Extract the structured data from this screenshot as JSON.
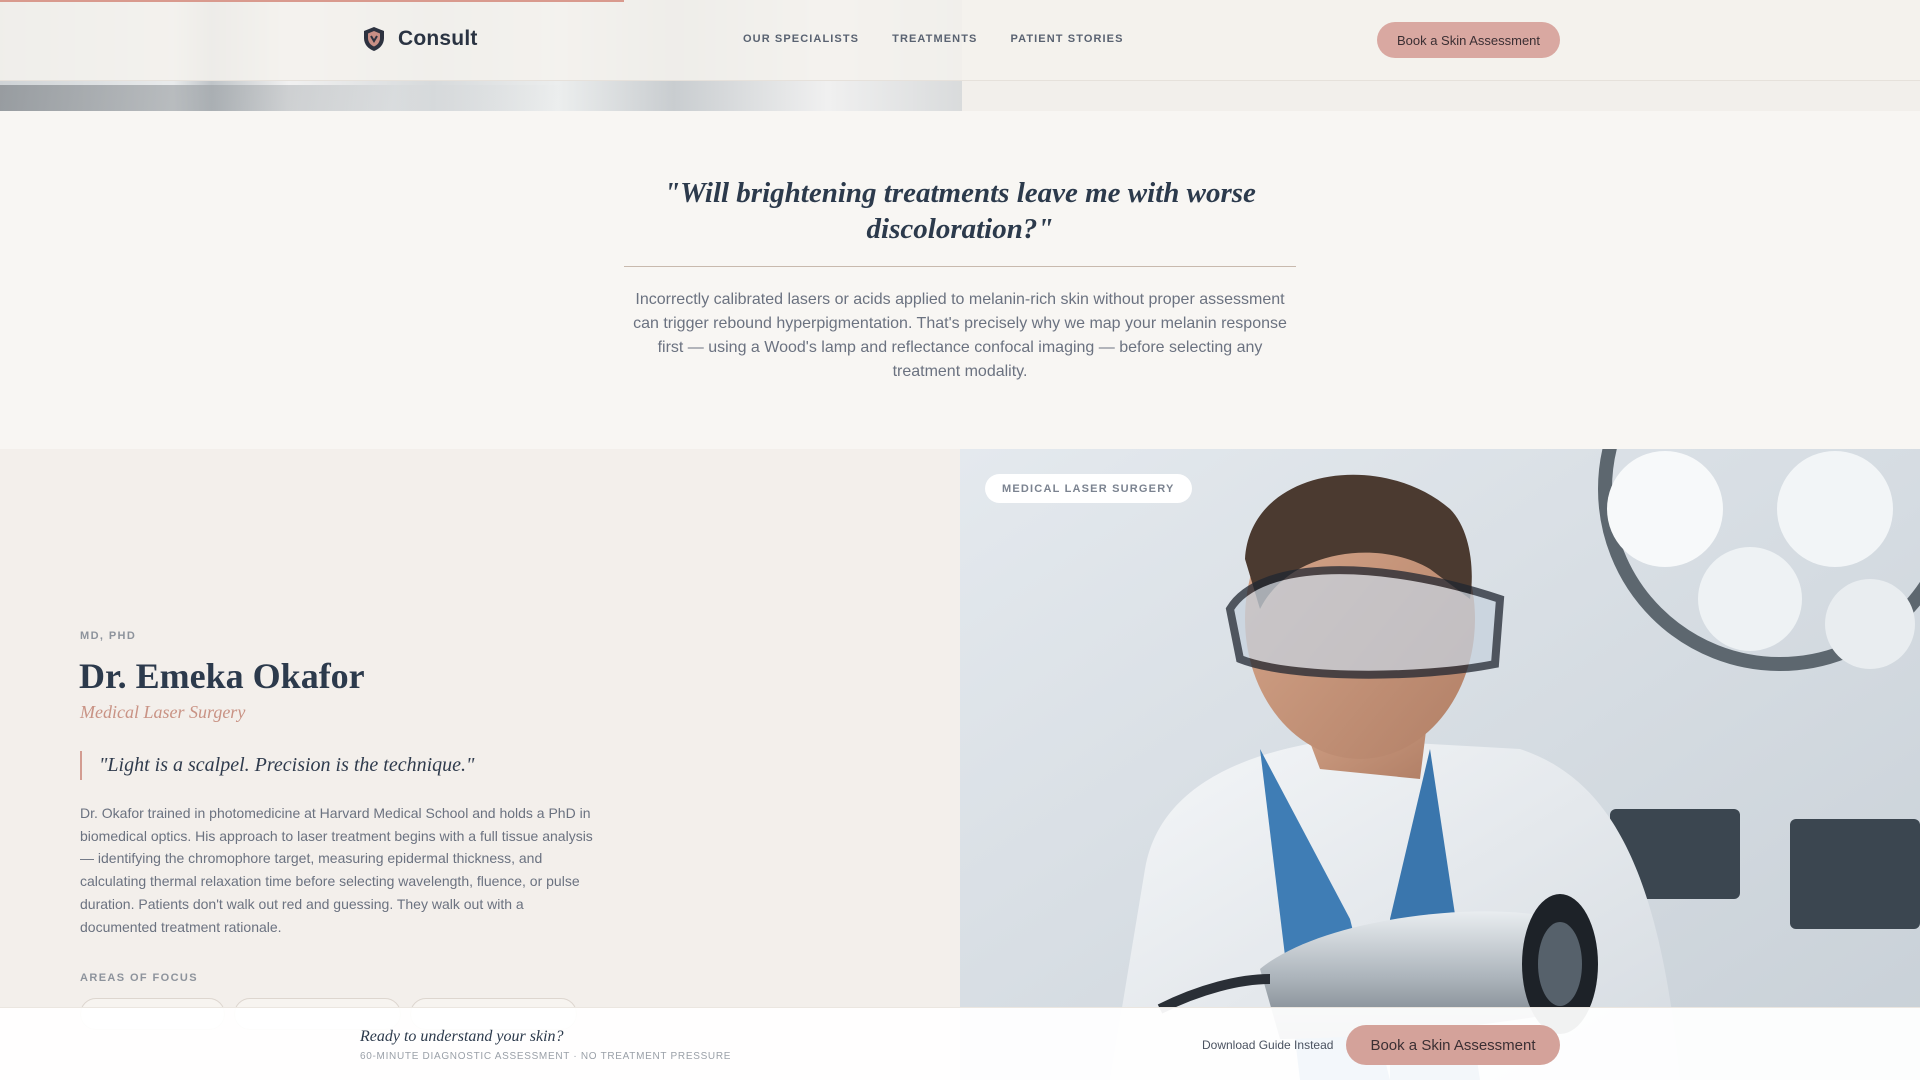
{
  "nav": {
    "brand": "Consult",
    "links": [
      "OUR SPECIALISTS",
      "TREATMENTS",
      "PATIENT STORIES"
    ],
    "cta": "Book a Skin Assessment"
  },
  "scroll_progress_percent": 32.5,
  "question": {
    "title": "\"Will brightening treatments leave me with worse discoloration?\"",
    "body": "Incorrectly calibrated lasers or acids applied to melanin-rich skin without proper assessment can trigger rebound hyperpigmentation. That's precisely why we map your melanin response first — using a Wood's lamp and reflectance confocal imaging — before selecting any treatment modality."
  },
  "specialist": {
    "credentials": "MD, PHD",
    "name": "Dr. Emeka Okafor",
    "specialty": "Medical Laser Surgery",
    "quote": "\"Light is a scalpel. Precision is the technique.\"",
    "bio": "Dr. Okafor trained in photomedicine at Harvard Medical School and holds a PhD in biomedical optics. His approach to laser treatment begins with a full tissue analysis — identifying the chromophore target, measuring epidermal thickness, and calculating thermal relaxation time before selecting wavelength, fluence, or pulse duration. Patients don't walk out red and guessing. They walk out with a documented treatment rationale.",
    "focus_label": "AREAS OF FOCUS",
    "photo_badge": "MEDICAL LASER SURGERY"
  },
  "sticky_bar": {
    "title": "Ready to understand your skin?",
    "subtitle": "60-MINUTE DIAGNOSTIC ASSESSMENT · NO TREATMENT PRESSURE",
    "secondary_link": "Download Guide Instead",
    "cta": "Book a Skin Assessment"
  },
  "colors": {
    "accent": "#d9a8a1",
    "text_dark": "#2c3a4c",
    "text_muted": "#6b7280",
    "specialty": "#c99385"
  },
  "icons": {
    "logo": "shield-icon"
  }
}
